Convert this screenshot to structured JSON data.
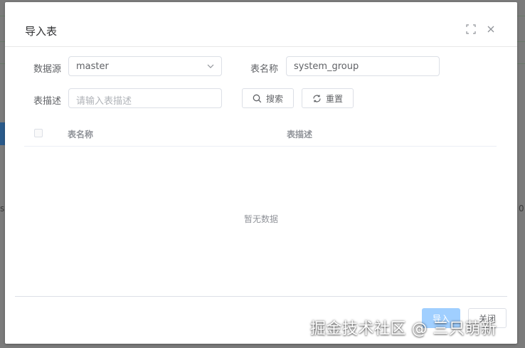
{
  "dialog": {
    "title": "导入表",
    "icons": {
      "fullscreen": "fullscreen-icon",
      "close": "close-icon"
    }
  },
  "form": {
    "datasource_label": "数据源",
    "datasource_value": "master",
    "table_name_label": "表名称",
    "table_name_value": "system_group",
    "table_desc_label": "表描述",
    "table_desc_placeholder": "请输入表描述",
    "search_button": "搜索",
    "reset_button": "重置"
  },
  "table": {
    "columns": [
      "表名称",
      "表描述"
    ],
    "empty_text": "暂无数据"
  },
  "footer": {
    "import_button": "导入",
    "close_button": "关闭"
  },
  "watermark": "掘金技术社区 @ 三只萌新",
  "background": {
    "fragment_a": "s",
    "fragment_b": "0"
  },
  "colors": {
    "primary_disabled": "#a0cfff",
    "border": "#dcdfe6",
    "overlay": "#7b7b7b"
  }
}
